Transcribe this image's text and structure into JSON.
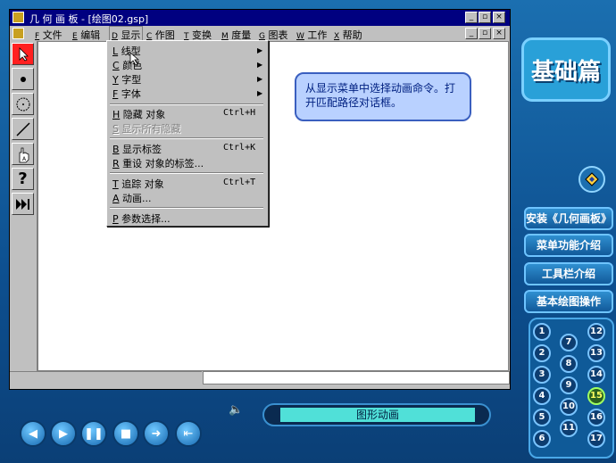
{
  "window": {
    "title": "几 何 画 板 - [绘图02.gsp]"
  },
  "menubar": [
    {
      "key": "F",
      "label": "文件"
    },
    {
      "key": "E",
      "label": "编辑"
    },
    {
      "key": "D",
      "label": "显示"
    },
    {
      "key": "C",
      "label": "作图"
    },
    {
      "key": "T",
      "label": "变换"
    },
    {
      "key": "M",
      "label": "度量"
    },
    {
      "key": "G",
      "label": "图表"
    },
    {
      "key": "W",
      "label": "工作"
    },
    {
      "key": "X",
      "label": "帮助"
    }
  ],
  "dropdown": {
    "items": [
      {
        "key": "L",
        "label": "线型",
        "shortcut": "",
        "submenu": true,
        "disabled": false
      },
      {
        "key": "C",
        "label": "颜色",
        "shortcut": "",
        "submenu": true,
        "disabled": false
      },
      {
        "key": "Y",
        "label": "字型",
        "shortcut": "",
        "submenu": true,
        "disabled": false
      },
      {
        "key": "F",
        "label": "字体",
        "shortcut": "",
        "submenu": true,
        "disabled": false
      },
      {
        "key": "H",
        "label": "隐藏 对象",
        "shortcut": "Ctrl+H",
        "submenu": false,
        "disabled": false
      },
      {
        "key": "S",
        "label": "显示所有隐藏",
        "shortcut": "",
        "submenu": false,
        "disabled": true
      },
      {
        "key": "B",
        "label": "显示标签",
        "shortcut": "Ctrl+K",
        "submenu": false,
        "disabled": false
      },
      {
        "key": "R",
        "label": "重设 对象的标签...",
        "shortcut": "",
        "submenu": false,
        "disabled": false
      },
      {
        "key": "T",
        "label": "追踪 对象",
        "shortcut": "Ctrl+T",
        "submenu": false,
        "disabled": false
      },
      {
        "key": "A",
        "label": "动画...",
        "shortcut": "",
        "submenu": false,
        "disabled": false
      },
      {
        "key": "P",
        "label": "参数选择...",
        "shortcut": "",
        "submenu": false,
        "disabled": false
      }
    ]
  },
  "callout": {
    "text": "从显示菜单中选择动画命令。打开匹配路径对话框。"
  },
  "sidepanel": {
    "logo": "基础篇",
    "buttons": [
      "安装《几何画板》",
      "菜单功能介绍",
      "工具栏介绍",
      "基本绘图操作"
    ],
    "numbers": [
      "1",
      "2",
      "3",
      "4",
      "5",
      "6",
      "7",
      "8",
      "9",
      "10",
      "11",
      "12",
      "13",
      "14",
      "15",
      "16",
      "17"
    ],
    "highlighted": "15"
  },
  "player": {
    "section_title": "图形动画"
  },
  "colors": {
    "titlebar": "#000080",
    "tool_selected": "#ff2020",
    "section_bar": "#50e0d8"
  }
}
